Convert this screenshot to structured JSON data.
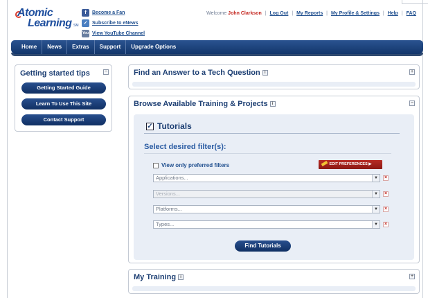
{
  "logo": {
    "line1": "Atomic",
    "line2": "Learning",
    "mark": "SM"
  },
  "social": [
    {
      "icon": "facebook-icon",
      "glyph": "f",
      "label": "Become a Fan"
    },
    {
      "icon": "enews-icon",
      "glyph": "✓",
      "label": "Subscribe to eNews"
    },
    {
      "icon": "youtube-icon",
      "glyph": "You",
      "label": "View YouTube Channel"
    }
  ],
  "topnav": {
    "welcome": "Welcome",
    "user": "John Clarkson",
    "sep": "|",
    "links": [
      "Log Out",
      "My Reports",
      "My Profile & Settings",
      "Help",
      "FAQ"
    ]
  },
  "nav": [
    "Home",
    "News",
    "Extras",
    "Support",
    "Upgrade Options"
  ],
  "tips": {
    "title": "Getting started tips",
    "toggle": "−",
    "buttons": [
      "Getting Started Guide",
      "Learn To Use This Site",
      "Contact Support"
    ]
  },
  "panels": {
    "answer": {
      "title": "Find an Answer to a Tech Question",
      "toggle": "+",
      "info": "i"
    },
    "browse": {
      "title": "Browse Available Training & Projects",
      "toggle": "−",
      "info": "i"
    },
    "training": {
      "title": "My Training",
      "toggle": "+",
      "info": "i"
    }
  },
  "tutorials": {
    "checkbox": "✓",
    "label": "Tutorials",
    "filters_heading": "Select desired filter(s):",
    "preferred_label": "View only preferred filters",
    "edit_preferences": "EDIT PREFERENCES ▶",
    "selects": [
      {
        "placeholder": "Applications...",
        "disabled": false
      },
      {
        "placeholder": "Versions...",
        "disabled": true
      },
      {
        "placeholder": "Platforms...",
        "disabled": false
      },
      {
        "placeholder": "Types...",
        "disabled": false
      }
    ],
    "arrow": "▼",
    "clear": "×",
    "submit": "Find Tutorials"
  }
}
